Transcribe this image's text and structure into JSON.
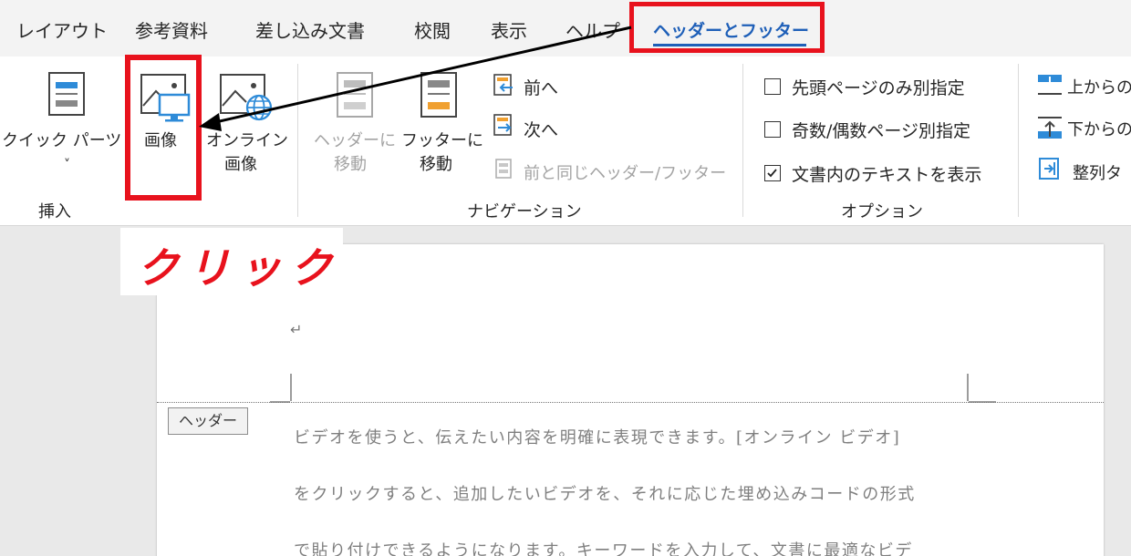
{
  "tabs": [
    {
      "label": "レイアウト",
      "active": false
    },
    {
      "label": "参考資料",
      "active": false
    },
    {
      "label": "差し込み文書",
      "active": false
    },
    {
      "label": "校閲",
      "active": false
    },
    {
      "label": "表示",
      "active": false
    },
    {
      "label": "ヘルプ",
      "active": false
    },
    {
      "label": "ヘッダーとフッター",
      "active": true
    }
  ],
  "ribbon": {
    "insert_group": {
      "label": "挿入",
      "quick_parts": "クイック パーツ",
      "quick_parts_chevron": "˅",
      "image": "画像",
      "online_image_line1": "オンライン",
      "online_image_line2": "画像"
    },
    "navigation_group": {
      "label": "ナビゲーション",
      "goto_header_line1": "ヘッダーに",
      "goto_header_line2": "移動",
      "goto_footer_line1": "フッターに",
      "goto_footer_line2": "移動",
      "previous": "前へ",
      "next": "次へ",
      "link_to_previous": "前と同じヘッダー/フッター"
    },
    "options_group": {
      "label": "オプション",
      "different_first_page": {
        "label": "先頭ページのみ別指定",
        "checked": false
      },
      "different_odd_even": {
        "label": "奇数/偶数ページ別指定",
        "checked": false
      },
      "show_document_text": {
        "label": "文書内のテキストを表示",
        "checked": true
      }
    },
    "position_group": {
      "header_from_top": "上からの",
      "footer_from_bottom": "下からの",
      "align_tab": "整列タ"
    }
  },
  "annotation": {
    "callout_text": "クリック",
    "highlight_color": "#e8121d"
  },
  "document": {
    "paragraph_mark": "↵",
    "header_tag": "ヘッダー",
    "lines": [
      "ビデオを使うと、伝えたい内容を明確に表現できます。[オンライン ビデオ]",
      "をクリックすると、追加したいビデオを、それに応じた埋め込みコードの形式",
      "で貼り付けできるようになります。キーワードを入力して、文書に最適なビデ"
    ]
  },
  "colors": {
    "accent_blue": "#1e5fb8",
    "icon_orange": "#f0a030",
    "icon_blue": "#2e8bd8"
  }
}
